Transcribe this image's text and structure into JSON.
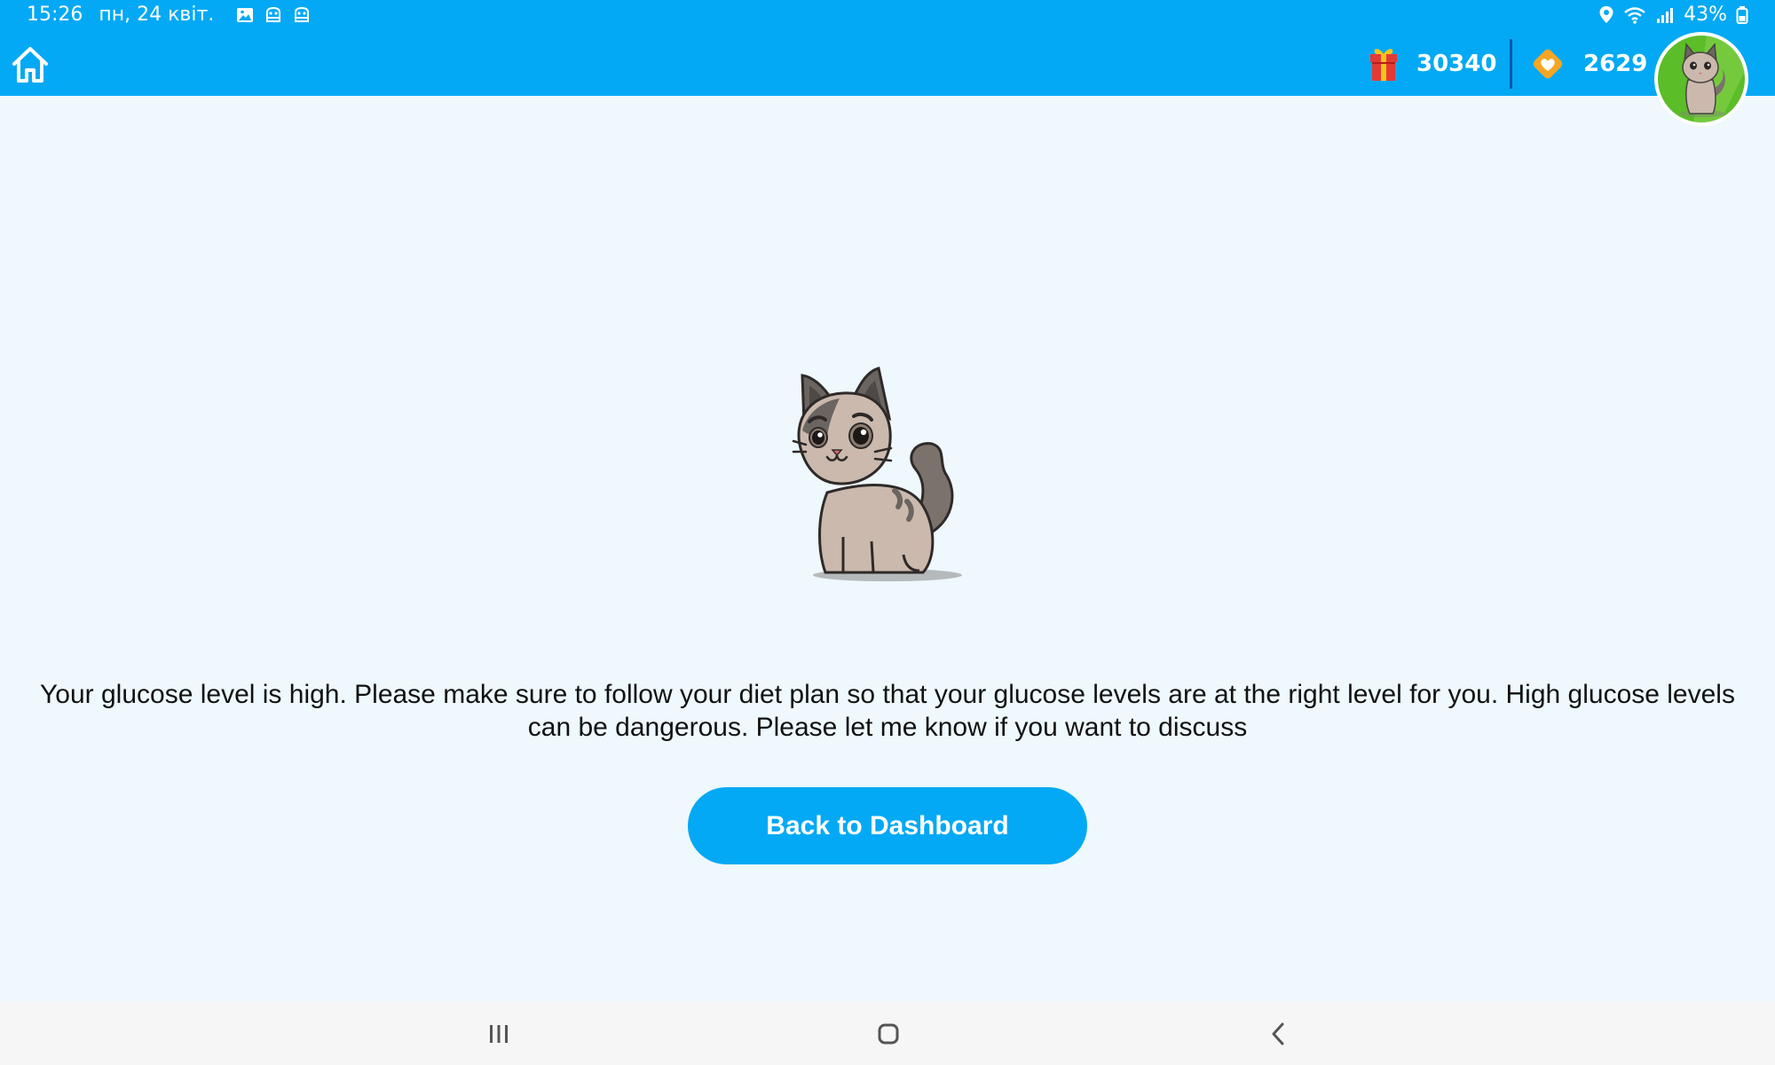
{
  "status_bar": {
    "time": "15:26",
    "date": "пн, 24 квіт.",
    "notification_icons": [
      "gallery-icon",
      "app-notification-icon",
      "app-notification-icon"
    ],
    "battery": "43%",
    "system_icons": [
      "location-icon",
      "wifi-icon",
      "signal-icon",
      "battery-icon"
    ]
  },
  "app_bar": {
    "color": "#03a9f4",
    "gifts_count": "30340",
    "hearts_count": "2629",
    "icons": {
      "home": "home-icon",
      "gift": "gift-icon",
      "heart": "heart-diamond-icon"
    }
  },
  "main": {
    "message": "Your glucose level is high.  Please make sure to follow your diet plan so that your glucose levels are at the right level for you.  High glucose levels can be dangerous. Please let me know if you want to discuss",
    "back_button_label": "Back to Dashboard",
    "illustration": "cat-mascot"
  },
  "nav_bar": {
    "icons": [
      "recent-apps-icon",
      "home-nav-icon",
      "back-icon"
    ]
  },
  "colors": {
    "accent": "#03a9f4",
    "background": "#eef8fd",
    "avatar_bg": "#5bbd28",
    "heart_badge": "#f5a623"
  }
}
